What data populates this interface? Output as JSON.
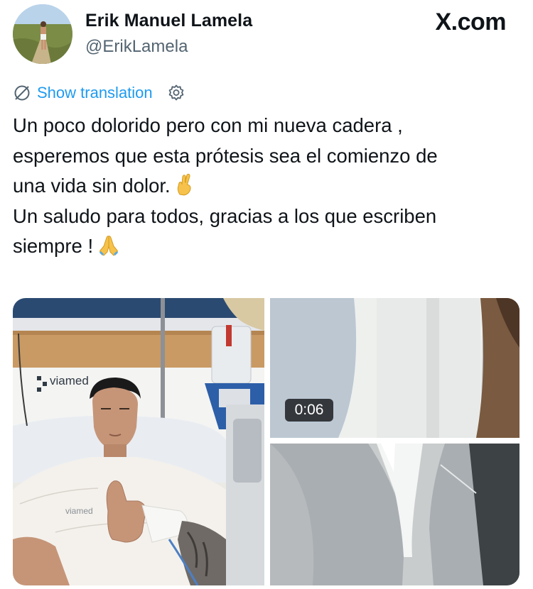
{
  "author": {
    "name": "Erik Manuel Lamela",
    "handle": "@ErikLamela"
  },
  "source_label": "X.com",
  "translation": {
    "link_text": "Show translation",
    "globe_icon": "translate-globe-icon",
    "settings_icon": "gear-icon"
  },
  "tweet": {
    "lines": [
      "Un poco dolorido pero con mi nueva cadera ,",
      "esperemos que esta prótesis sea el comienzo de",
      "una vida sin dolor.",
      "Un saludo para todos, gracias a los que escriben",
      "siempre !"
    ],
    "emoji_after_line_3": "crossed-fingers",
    "emoji_after_line_5": "folded-hands"
  },
  "media": {
    "tiles": [
      {
        "name": "hospital-selfie-photo",
        "kind": "photo"
      },
      {
        "name": "bandaged-leg-video",
        "kind": "video",
        "duration": "0:06"
      },
      {
        "name": "hip-xray-photo",
        "kind": "photo"
      }
    ],
    "photo_wall_label": "viamed",
    "gown_label": "viamed"
  },
  "colors": {
    "text_primary": "#0f1419",
    "text_secondary": "#536471",
    "link_blue": "#1d9bf0"
  }
}
